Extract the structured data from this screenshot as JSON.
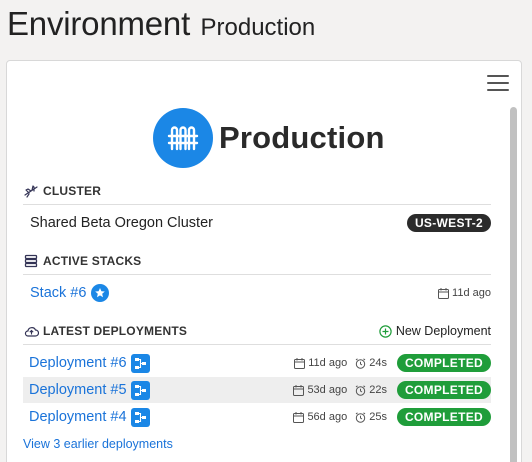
{
  "header": {
    "title": "Environment",
    "subtitle": "Production"
  },
  "environment": {
    "name": "Production",
    "icon": "stack-icon",
    "icon_color": "#1b87e6"
  },
  "cluster": {
    "heading": "CLUSTER",
    "icon": "plane-icon",
    "name": "Shared Beta Oregon Cluster",
    "region": "US-WEST-2"
  },
  "active_stacks": {
    "heading": "ACTIVE STACKS",
    "icon": "layers-icon",
    "items": [
      {
        "label": "Stack #6",
        "date": "11d ago"
      }
    ]
  },
  "deployments": {
    "heading": "LATEST DEPLOYMENTS",
    "icon": "cloud-icon",
    "new_label": "New Deployment",
    "items": [
      {
        "label": "Deployment #6",
        "date": "11d ago",
        "duration": "24s",
        "status": "COMPLETED"
      },
      {
        "label": "Deployment #5",
        "date": "53d ago",
        "duration": "22s",
        "status": "COMPLETED"
      },
      {
        "label": "Deployment #4",
        "date": "56d ago",
        "duration": "25s",
        "status": "COMPLETED"
      }
    ],
    "earlier_link": "View 3 earlier deployments"
  },
  "colors": {
    "accent": "#1b87e6",
    "link": "#1a73d9",
    "success": "#1f9d3a",
    "dark_badge": "#2b2b2b"
  }
}
